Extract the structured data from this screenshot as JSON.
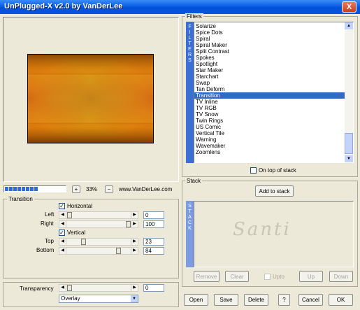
{
  "window": {
    "title": "UnPlugged-X v2.0 by VanDerLee",
    "close_glyph": "X"
  },
  "preview": {
    "zoom_value": "33%",
    "zoom_plus": "+",
    "zoom_minus": "−",
    "website": "www.VanDerLee.com",
    "progress_fraction": 0.56
  },
  "transition": {
    "group_label": "Transition",
    "horizontal_label": "Horizontal",
    "horizontal_checked": true,
    "left_label": "Left",
    "left_value": "0",
    "right_label": "Right",
    "right_value": "100",
    "vertical_label": "Vertical",
    "vertical_checked": true,
    "top_label": "Top",
    "top_value": "23",
    "bottom_label": "Bottom",
    "bottom_value": "84",
    "check_glyph": "✓"
  },
  "transparency": {
    "label": "Transparency",
    "value": "0",
    "blend_mode": "Overlay"
  },
  "filters": {
    "group_label": "Filters",
    "side_letters": [
      "F",
      "I",
      "L",
      "T",
      "E",
      "R",
      "S"
    ],
    "items": [
      "Solarize",
      "Spice Dots",
      "Spiral",
      "Spiral Maker",
      "Split Contrast",
      "Spokes",
      "Spotlight",
      "Star Maker",
      "Starchart",
      "Swap",
      "Tan Deform",
      "Transition",
      "TV Inline",
      "TV RGB",
      "TV Snow",
      "Twin Rings",
      "US Comic",
      "Vertical Tile",
      "Warning",
      "Wavemaker",
      "Zoomlens"
    ],
    "selected": "Transition",
    "on_top_label": "On top of stack"
  },
  "stack": {
    "group_label": "Stack",
    "side_letters": [
      "S",
      "T",
      "A",
      "C",
      "K"
    ],
    "add_label": "Add to stack",
    "watermark": "Santi",
    "remove_label": "Remove",
    "clear_label": "Clear",
    "upto_label": "Upto",
    "up_label": "Up",
    "down_label": "Down"
  },
  "footer": {
    "open": "Open",
    "save": "Save",
    "delete": "Delete",
    "help": "?",
    "cancel": "Cancel",
    "ok": "OK"
  },
  "colors": {
    "accent": "#316ac5",
    "side_bar": "#3b6fd6",
    "stack_bar": "#7d9be0"
  }
}
